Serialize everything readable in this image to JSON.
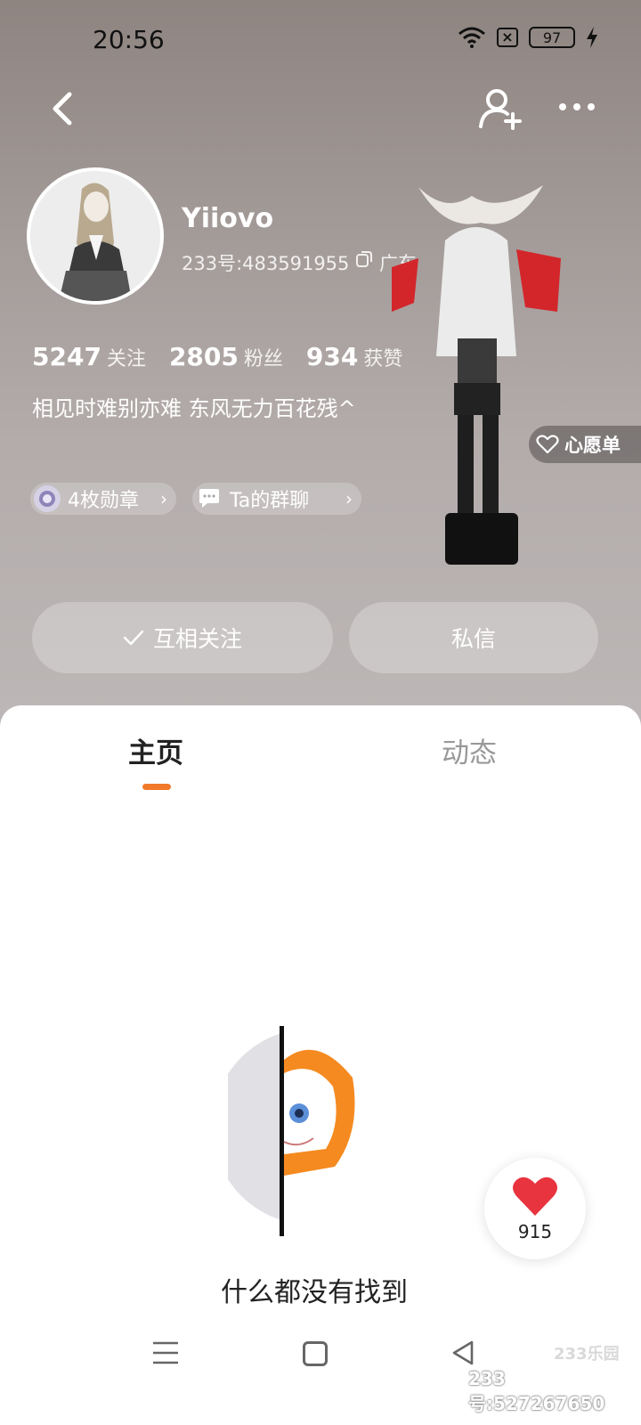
{
  "status": {
    "time": "20:56",
    "battery": "97"
  },
  "profile": {
    "name": "Yiiovo",
    "id_text": "233号:483591955",
    "region": "广东",
    "stats": [
      {
        "value": "5247",
        "label": "关注"
      },
      {
        "value": "2805",
        "label": "粉丝"
      },
      {
        "value": "934",
        "label": "获赞"
      }
    ],
    "bio": "相见时难别亦难 东风无力百花残^",
    "chips": {
      "badges": "4枚勋章",
      "group": "Ta的群聊"
    },
    "wishlist": "心愿单"
  },
  "actions": {
    "follow": "互相关注",
    "message": "私信"
  },
  "tabs": {
    "home": "主页",
    "feed": "动态"
  },
  "empty": {
    "text": "什么都没有找到"
  },
  "like": {
    "count": "915"
  },
  "watermark": {
    "logo": "233乐园",
    "id": "233号:527267650"
  },
  "colors": {
    "accent": "#f07a2a",
    "heart": "#e8343f"
  }
}
